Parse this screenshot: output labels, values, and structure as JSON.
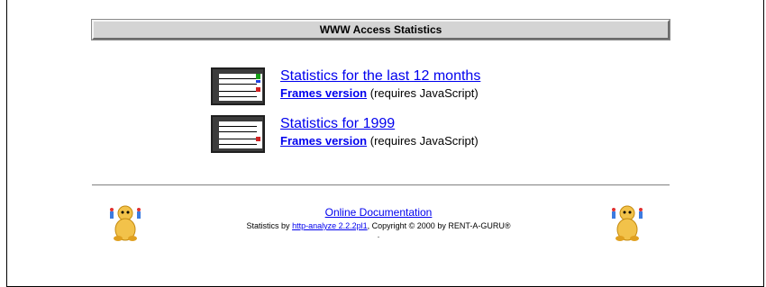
{
  "page": {
    "title": "WWW Access Statistics"
  },
  "stats": [
    {
      "link_label": "Statistics for the last 12 months",
      "frames_label": "Frames version",
      "frames_note": "(requires JavaScript)"
    },
    {
      "link_label": "Statistics for 1999",
      "frames_label": "Frames version",
      "frames_note": "(requires JavaScript)"
    }
  ],
  "footer": {
    "doc_link": "Online Documentation",
    "credit_prefix": "Statistics by",
    "credit_link": "http-analyze 2.2.2pl1",
    "credit_suffix": ", Copyright © 2000 by RENT-A-GURU®",
    "dot": "."
  },
  "icons": {
    "stats_icon": "statistics-report-icon",
    "mascot": "guru-mascot-icon"
  }
}
